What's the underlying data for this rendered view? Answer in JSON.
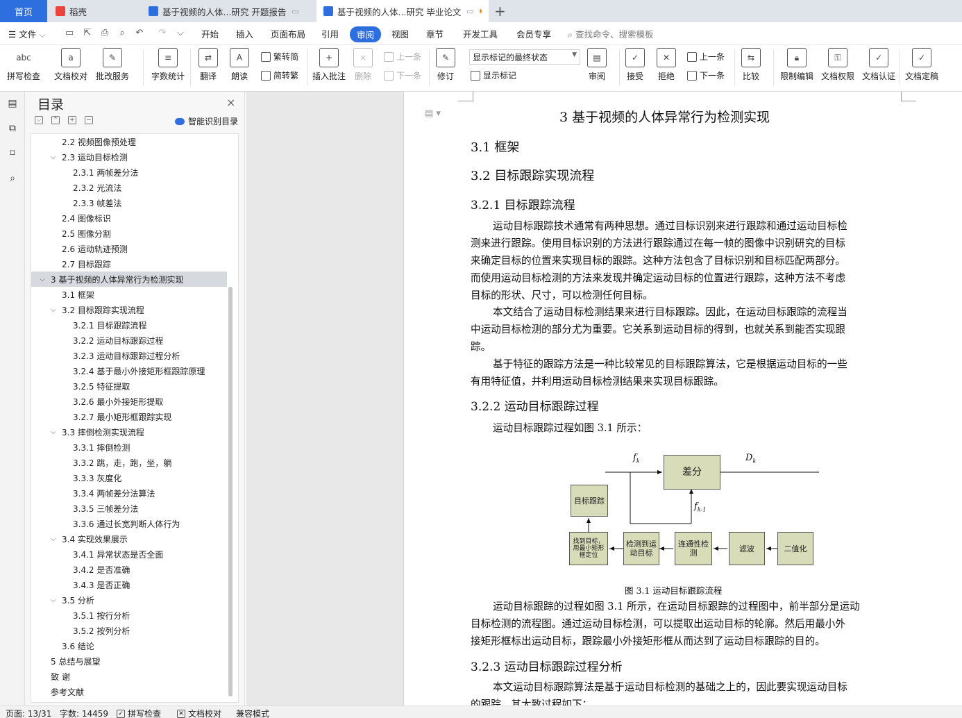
{
  "tabs": {
    "home": "首页",
    "items": [
      {
        "label": "稻壳",
        "extra": ""
      },
      {
        "label": "基于视频的人体...研究 开题报告",
        "extra": "▭"
      },
      {
        "label": "基于视频的人体...研究 毕业论文",
        "extra": "▭"
      }
    ],
    "new_tab": "+"
  },
  "menu": {
    "file": "文件",
    "items": [
      "开始",
      "插入",
      "页面布局",
      "引用",
      "审阅",
      "视图",
      "章节",
      "开发工具",
      "会员专享"
    ],
    "search": "查找命令、搜索模板"
  },
  "ribbon": {
    "spellcheck": "拼写检查",
    "proofread": "文档校对",
    "batch": "批改服务",
    "wordcount": "字数统计",
    "translate": "翻译",
    "read": "朗读",
    "trad": "繁转简",
    "simp": "简转繁",
    "insert_comment": "插入批注",
    "delete": "删除",
    "prev_comment": "上一条",
    "next_comment": "下一条",
    "track": "修订",
    "markup_state": "显示标记的最终状态",
    "show_markup": "显示标记",
    "review": "审阅",
    "accept": "接受",
    "reject": "拒绝",
    "prev_change": "上一条",
    "next_change": "下一条",
    "compare": "比较",
    "restrict": "限制编辑",
    "perms": "文档权限",
    "certify": "文档认证",
    "finalize": "文档定稿"
  },
  "nav": {
    "title": "目录",
    "smart": "智能识别目录",
    "toc": [
      {
        "label": "2.2  视频图像预处理"
      },
      {
        "label": "2.3  运动目标检测"
      },
      {
        "label": "2.3.1  两帧差分法"
      },
      {
        "label": "2.3.2  光流法"
      },
      {
        "label": "2.3.3  帧差法"
      },
      {
        "label": "2.4  图像标识"
      },
      {
        "label": "2.5  图像分割"
      },
      {
        "label": "2.6  运动轨迹预测"
      },
      {
        "label": "2.7  目标跟踪"
      },
      {
        "label": "3  基于视频的人体异常行为检测实现"
      },
      {
        "label": "3.1  框架"
      },
      {
        "label": "3.2  目标跟踪实现流程"
      },
      {
        "label": "3.2.1 目标跟踪流程"
      },
      {
        "label": "3.2.2  运动目标跟踪过程"
      },
      {
        "label": "3.2.3  运动目标跟踪过程分析"
      },
      {
        "label": "3.2.4 基于最小外接矩形框跟踪原理"
      },
      {
        "label": "3.2.5 特征提取"
      },
      {
        "label": "3.2.6  最小外接矩形提取"
      },
      {
        "label": "3.2.7 最小矩形框跟踪实现"
      },
      {
        "label": "3.3  摔倒检测实现流程"
      },
      {
        "label": "3.3.1 摔倒检测"
      },
      {
        "label": "3.3.2  跳，走，跑，坐，躺"
      },
      {
        "label": "3.3.3  灰度化"
      },
      {
        "label": "3.3.4  两帧差分法算法"
      },
      {
        "label": "3.3.5  三帧差分法"
      },
      {
        "label": "3.3.6  通过长宽判断人体行为"
      },
      {
        "label": "3.4 实现效果展示"
      },
      {
        "label": "3.4.1 异常状态是否全面"
      },
      {
        "label": "3.4.2  是否准确"
      },
      {
        "label": "3.4.3 是否正确"
      },
      {
        "label": "3.5  分析"
      },
      {
        "label": "3.5.1  按行分析"
      },
      {
        "label": "3.5.2  按列分析"
      },
      {
        "label": "3.6 结论"
      },
      {
        "label": "5  总结与展望"
      },
      {
        "label": "致    谢"
      },
      {
        "label": "参考文献"
      }
    ]
  },
  "doc": {
    "chapter": "3   基于视频的人体异常行为检测实现",
    "s31": "3.1   框架",
    "s32": "3.2   目标跟踪实现流程",
    "s321": "3.2.1 目标跟踪流程",
    "p1": [
      "运动目标跟踪技术通常有两种思想。通过目标识别来进行跟踪和通过运动目标检",
      "测来进行跟踪。使用目标识别的方法进行跟踪通过在每一帧的图像中识别研究的目标",
      "来确定目标的位置来实现目标的跟踪。这种方法包含了目标识别和目标匹配两部分。",
      "而使用运动目标检测的方法来发现并确定运动目标的位置进行跟踪，这种方法不考虑",
      "目标的形状、尺寸，可以检测任何目标。"
    ],
    "p2": [
      "本文结合了运动目标检测结果来进行目标跟踪。因此，在运动目标跟踪的流程当",
      "中运动目标检测的部分尤为重要。它关系到运动目标的得到，也就关系到能否实现跟",
      "踪。"
    ],
    "p3": [
      "基于特征的跟踪方法是一种比较常见的目标跟踪算法，它是根据运动目标的一些",
      "有用特征值，并利用运动目标检测结果来实现目标跟踪。"
    ],
    "s322": "3.2.2   运动目标跟踪过程",
    "p4": "运动目标跟踪过程如图 3.1 所示：",
    "figure": {
      "diff": "差分",
      "track": "目标跟踪",
      "find": "找到目标，用最小矩形框定位",
      "detect": "检测到运动目标",
      "conn": "连通性检测",
      "filter": "滤波",
      "binar": "二值化",
      "fk": "f",
      "fk_sub": "k",
      "fk1": "f",
      "fk1_sub": "k-1",
      "dk": "D",
      "dk_sub": "k"
    },
    "caption": "图 3.1   运动目标跟踪流程",
    "p5": [
      "运动目标跟踪的过程如图 3.1 所示，在运动目标跟踪的过程图中，前半部分是运动",
      "目标检测的流程图。通过运动目标检测，可以提取出运动目标的轮廓。然后用最小外",
      "接矩形框标出运动目标，跟踪最小外接矩形框从而达到了运动目标跟踪的目的。"
    ],
    "s323": "3.2.3   运动目标跟踪过程分析",
    "p6": [
      "本文运动目标跟踪算法是基于运动目标检测的基础之上的，因此要实现运动目标",
      "的跟踪，其大致过程如下："
    ]
  },
  "status": {
    "page": "页面: 13/31",
    "words": "字数: 14459",
    "spell": "拼写检查",
    "proof": "文档校对",
    "compat": "兼容模式"
  },
  "colors": {
    "accent": "#2e6fe0",
    "figure_box": "#d8dcb8",
    "wps_red": "#e8453c"
  }
}
